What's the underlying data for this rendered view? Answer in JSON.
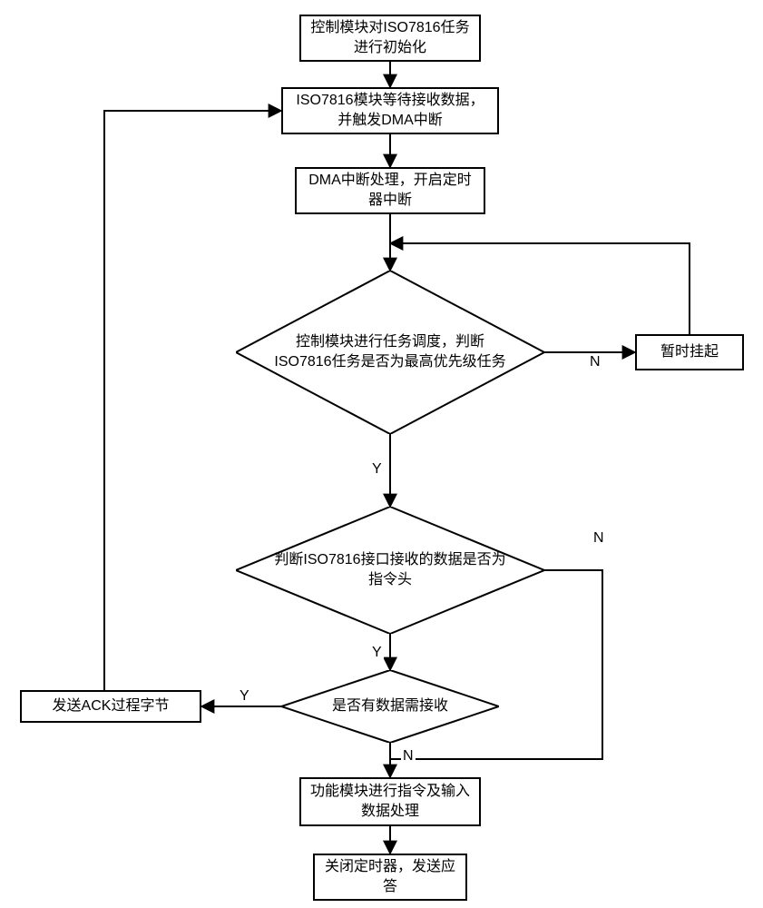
{
  "nodes": {
    "n1": "控制模块对ISO7816任务进行初始化",
    "n2": "ISO7816模块等待接收数据，并触发DMA中断",
    "n3": "DMA中断处理，开启定时器中断",
    "n4": "控制模块进行任务调度，判断ISO7816任务是否为最高优先级任务",
    "n5": "暂时挂起",
    "n6": "判断ISO7816接口接收的数据是否为指令头",
    "n7": "是否有数据需接收",
    "n8": "发送ACK过程字节",
    "n9": "功能模块进行指令及输入数据处理",
    "n10": "关闭定时器，发送应答"
  },
  "labels": {
    "yes": "Y",
    "no": "N"
  }
}
